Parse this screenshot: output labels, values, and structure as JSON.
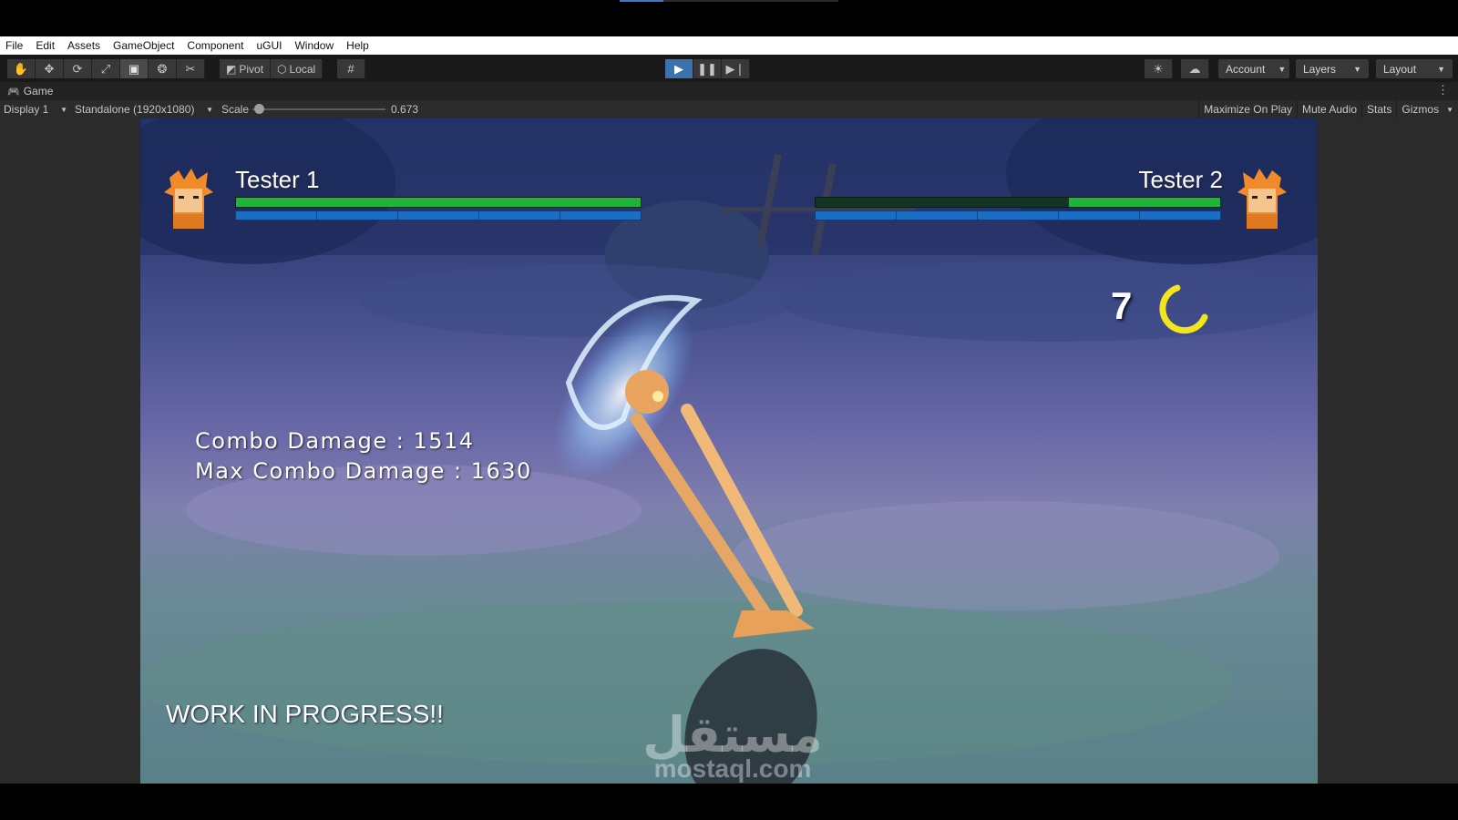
{
  "menu": [
    "File",
    "Edit",
    "Assets",
    "GameObject",
    "Component",
    "uGUI",
    "Window",
    "Help"
  ],
  "toolbar": {
    "pivot_label": "Pivot",
    "local_label": "Local",
    "account_label": "Account",
    "layers_label": "Layers",
    "layout_label": "Layout",
    "play_accent": "#3a72b0"
  },
  "tab": {
    "label": "Game"
  },
  "gamebar": {
    "display": "Display 1",
    "resolution": "Standalone (1920x1080)",
    "scale_label": "Scale",
    "scale_value": "0.673",
    "scale_fraction": 0.05,
    "maximize": "Maximize On Play",
    "mute": "Mute Audio",
    "stats": "Stats",
    "gizmos": "Gizmos"
  },
  "hud": {
    "player1": {
      "name": "Tester 1",
      "health_fraction": 1.0
    },
    "player2": {
      "name": "Tester 2",
      "health_fraction": 0.375
    },
    "health_color": "#1fb53a",
    "chakra_color": "#1a6fc4",
    "timer": "7",
    "combo_damage": "Combo Damage : 1514",
    "max_combo_damage": "Max Combo Damage : 1630",
    "wip": "WORK IN PROGRESS!!"
  },
  "watermark": {
    "arabic": "مستقل",
    "latin": "mostaql.com"
  }
}
